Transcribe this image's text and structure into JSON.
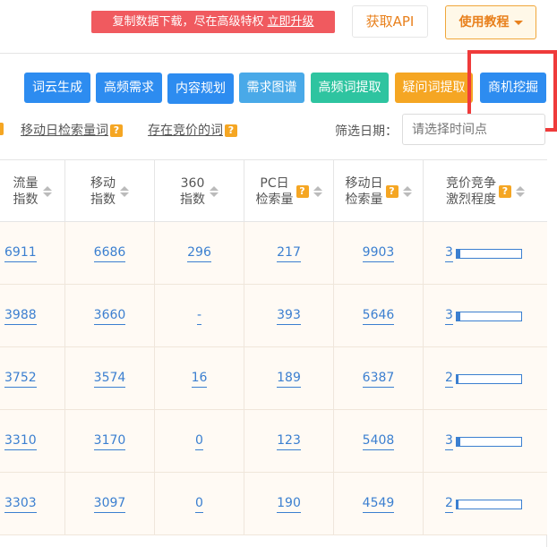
{
  "header": {
    "promo_text": "复制数据下载，尽在高级特权",
    "promo_link": "立即升级",
    "api_label": "获取API",
    "tutorial_label": "使用教程"
  },
  "tools": [
    {
      "label": "词云生成",
      "color": "#2d8cf0"
    },
    {
      "label": "高频需求",
      "color": "#2d8cf0"
    },
    {
      "label": "内容规划",
      "color": "#2d8cf0"
    },
    {
      "label": "需求图谱",
      "color": "#49a9e8"
    },
    {
      "label": "高频词提取",
      "color": "#2ec4a0"
    },
    {
      "label": "疑问词提取",
      "color": "#f5a623"
    },
    {
      "label": "商机挖掘",
      "color": "#2d8cf0"
    }
  ],
  "filters": {
    "mobile_search": "移动日检索量词",
    "bidding": "存在竞价的词",
    "date_label": "筛选日期：",
    "date_placeholder": "请选择时间点",
    "help_glyph": "?"
  },
  "columns": [
    {
      "line1": "流量",
      "line2": "指数",
      "help": false
    },
    {
      "line1": "移动",
      "line2": "指数",
      "help": false
    },
    {
      "line1": "360",
      "line2": "指数",
      "help": false
    },
    {
      "line1": "PC日",
      "line2": "检索量",
      "help": true
    },
    {
      "line1": "移动日",
      "line2": "检索量",
      "help": true
    },
    {
      "line1": "竞价竞争",
      "line2": "激烈程度",
      "help": true
    }
  ],
  "rows": [
    {
      "traffic": "6911",
      "mobile": "6686",
      "idx360": "296",
      "pc": "217",
      "mobile_search": "9903",
      "competition": "3",
      "competition_level": 0.05
    },
    {
      "traffic": "3988",
      "mobile": "3660",
      "idx360": "-",
      "pc": "393",
      "mobile_search": "5646",
      "competition": "3",
      "competition_level": 0.05
    },
    {
      "traffic": "3752",
      "mobile": "3574",
      "idx360": "16",
      "pc": "189",
      "mobile_search": "6387",
      "competition": "2",
      "competition_level": 0.03
    },
    {
      "traffic": "3310",
      "mobile": "3170",
      "idx360": "0",
      "pc": "123",
      "mobile_search": "5408",
      "competition": "3",
      "competition_level": 0.05
    },
    {
      "traffic": "3303",
      "mobile": "3097",
      "idx360": "0",
      "pc": "190",
      "mobile_search": "4549",
      "competition": "2",
      "competition_level": 0.03
    }
  ],
  "colors": {
    "highlight": "#ef3b3b",
    "link": "#3b7fd0",
    "row_bg": "#fffaf4"
  }
}
